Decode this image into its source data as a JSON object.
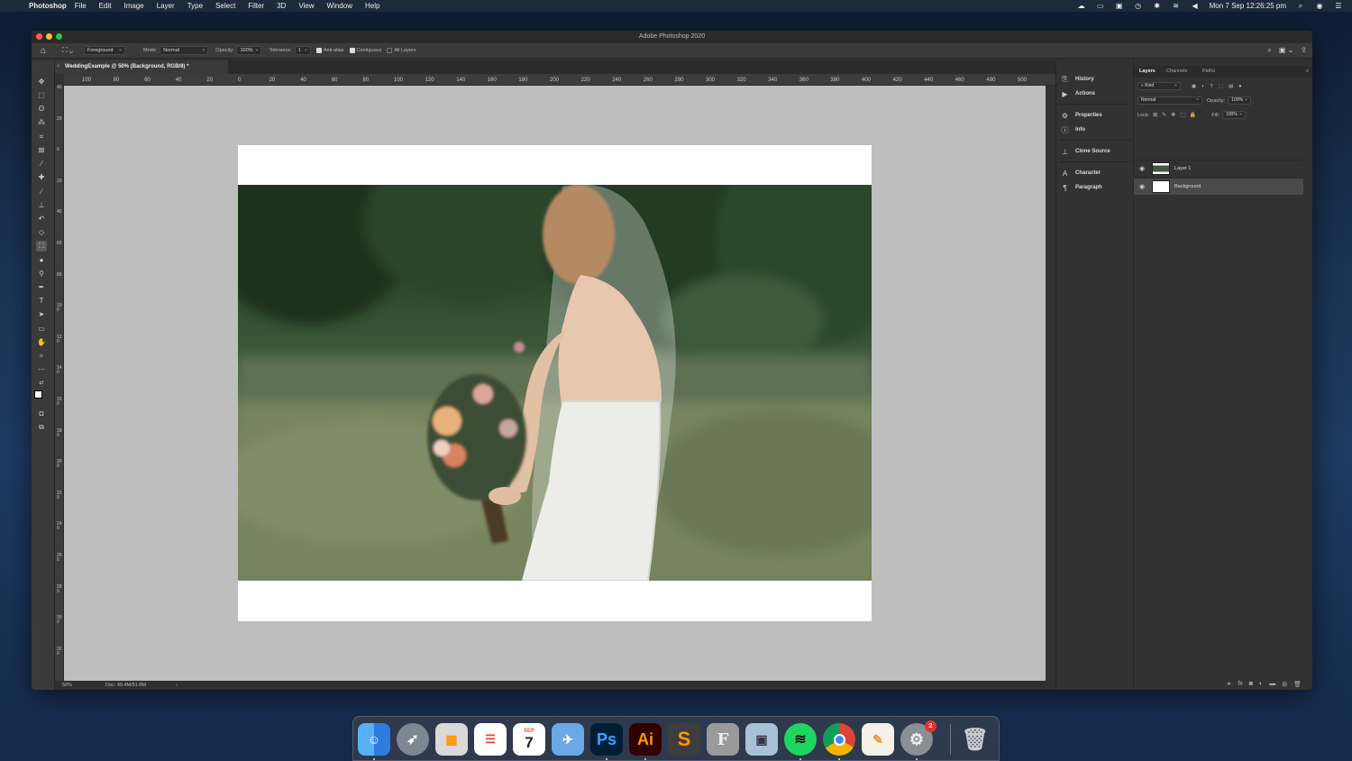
{
  "menubar": {
    "app_name": "Photoshop",
    "menus": [
      "File",
      "Edit",
      "Image",
      "Layer",
      "Type",
      "Select",
      "Filter",
      "3D",
      "View",
      "Window",
      "Help"
    ],
    "datetime": "Mon 7 Sep  12:26:25 pm"
  },
  "window": {
    "title": "Adobe Photoshop 2020"
  },
  "options": {
    "fill_source": "Foreground",
    "mode_label": "Mode:",
    "mode_value": "Normal",
    "opacity_label": "Opacity:",
    "opacity_value": "100%",
    "tolerance_label": "Tolerance:",
    "tolerance_value": "1",
    "anti_alias": "Anti-alias",
    "contiguous": "Contiguous",
    "all_layers": "All Layers"
  },
  "document": {
    "tab_title": "WeddingExample @ 50% (Background, RGB/8) *",
    "close": "×"
  },
  "ruler": {
    "top_ticks": [
      "100",
      "80",
      "60",
      "40",
      "20",
      "0",
      "20",
      "40",
      "60",
      "80",
      "100",
      "120",
      "140",
      "160",
      "180",
      "200",
      "220",
      "240",
      "260",
      "280",
      "300",
      "320",
      "340",
      "360",
      "380",
      "400",
      "420",
      "440",
      "460",
      "480",
      "500"
    ],
    "left_ticks": [
      "40",
      "20",
      "0",
      "20",
      "40",
      "60",
      "80",
      "100",
      "120",
      "140",
      "160",
      "180",
      "200",
      "220",
      "240",
      "260",
      "280",
      "300",
      "320"
    ]
  },
  "status": {
    "zoom": "50%",
    "doc_size": "Doc: 49.4M/51.8M"
  },
  "mid_panel": {
    "items": [
      "History",
      "Actions",
      "Properties",
      "Info",
      "Clone Source",
      "Character",
      "Paragraph"
    ]
  },
  "layers_panel": {
    "tabs": [
      "Layers",
      "Channels",
      "Paths"
    ],
    "filter_kind": "Kind",
    "blend_mode": "Normal",
    "opacity_label": "Opacity:",
    "opacity_value": "100%",
    "lock_label": "Lock:",
    "fill_label": "Fill:",
    "fill_value": "100%",
    "layers": [
      {
        "name": "Layer 1",
        "selected": false
      },
      {
        "name": "Background",
        "selected": true
      }
    ]
  },
  "dock": {
    "apps": [
      "Finder",
      "Launchpad",
      "Calculator",
      "Reminders",
      "Calendar",
      "Preview",
      "Photoshop",
      "Illustrator",
      "Sublime Text",
      "Fontlab",
      "Image Capture",
      "Spotify",
      "Chrome",
      "TextEdit",
      "System Preferences"
    ],
    "calendar_month": "SEP",
    "calendar_day": "7",
    "ps_label": "Ps",
    "ai_label": "Ai",
    "f_label": "F",
    "settings_badge": "2"
  }
}
